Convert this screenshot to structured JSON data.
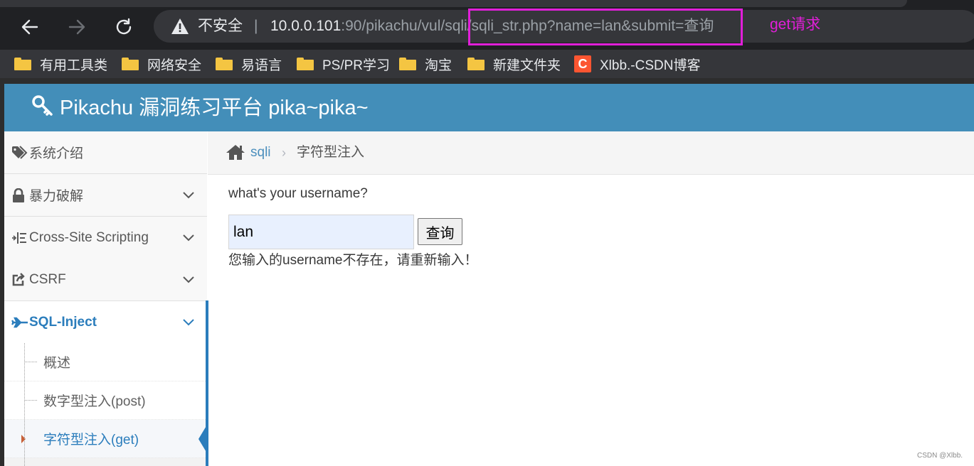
{
  "browser": {
    "security_label": "不安全",
    "separator": "|",
    "url_host": "10.0.0.101",
    "url_path": ":90/pikachu/vul/sqli/sqli_str.php?name=lan&submit=查询",
    "annotation": "get请求",
    "icons": [
      "back-icon",
      "forward-icon",
      "reload-icon",
      "warning-icon"
    ],
    "colors": {
      "chrome": "#202124",
      "omnibox": "#35363a",
      "highlight": "#e11fd9"
    }
  },
  "bookmarks": [
    {
      "label": "有用工具类",
      "icon": "folder-icon"
    },
    {
      "label": "网络安全",
      "icon": "folder-icon"
    },
    {
      "label": "易语言",
      "icon": "folder-icon"
    },
    {
      "label": "PS/PR学习",
      "icon": "folder-icon"
    },
    {
      "label": "淘宝",
      "icon": "folder-icon"
    },
    {
      "label": "新建文件夹",
      "icon": "folder-icon"
    },
    {
      "label": "Xlbb.-CSDN博客",
      "icon": "csdn-icon",
      "icon_text": "C"
    }
  ],
  "header": {
    "title": "Pikachu 漏洞练习平台 pika~pika~",
    "icon": "key-icon",
    "color": "#438eb9"
  },
  "sidebar": {
    "items": [
      {
        "label": "系统介绍",
        "icon": "tags-icon"
      },
      {
        "label": "暴力破解",
        "icon": "lock-icon"
      },
      {
        "label": "Cross-Site Scripting",
        "icon": "indent-icon"
      },
      {
        "label": "CSRF",
        "icon": "share-icon"
      },
      {
        "label": "SQL-Inject",
        "icon": "plane-icon"
      }
    ],
    "subitems": [
      {
        "label": "概述"
      },
      {
        "label": "数字型注入(post)"
      },
      {
        "label": "字符型注入(get)"
      }
    ],
    "accent_color": "#2b7dbc"
  },
  "breadcrumb": {
    "section": "sqli",
    "separator": "›",
    "current": "字符型注入"
  },
  "main": {
    "prompt": "what's your username?",
    "input_value": "lan",
    "submit_label": "查询",
    "result": "您输入的username不存在，请重新输入！"
  },
  "watermark": "CSDN @Xlbb."
}
